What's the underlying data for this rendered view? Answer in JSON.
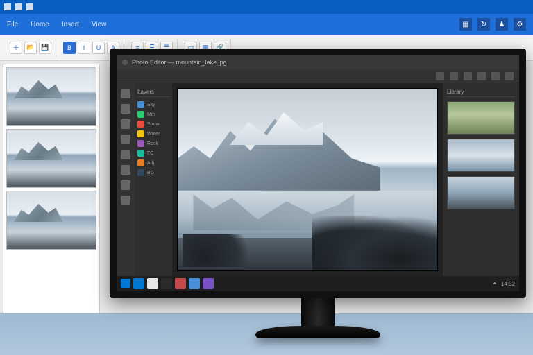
{
  "outer": {
    "ribbon_tabs": [
      "File",
      "Home",
      "Insert",
      "View"
    ],
    "ribbon_right_icons": [
      "grid-icon",
      "sync-icon",
      "user-icon",
      "settings-icon"
    ]
  },
  "left_panel": {
    "thumbs": [
      "mountain-lake-1",
      "mountain-lake-2",
      "mountain-lake-3"
    ]
  },
  "editor": {
    "title": "Photo Editor — mountain_lake.jpg",
    "top_icons": [
      "undo-icon",
      "redo-icon",
      "save-icon",
      "export-icon",
      "cloud-icon",
      "settings-icon"
    ],
    "side_tools": [
      "move-icon",
      "select-icon",
      "crop-icon",
      "brush-icon",
      "eraser-icon",
      "text-icon",
      "eyedropper-icon",
      "zoom-icon"
    ],
    "layers_title": "Layers",
    "layers": [
      {
        "name": "Sky",
        "color": "#4a90d9"
      },
      {
        "name": "Mtn",
        "color": "#2ecc71"
      },
      {
        "name": "Snow",
        "color": "#e74c3c"
      },
      {
        "name": "Water",
        "color": "#f1c40f"
      },
      {
        "name": "Rock",
        "color": "#9b59b6"
      },
      {
        "name": "FG",
        "color": "#1abc9c"
      },
      {
        "name": "Adj",
        "color": "#e67e22"
      },
      {
        "name": "BG",
        "color": "#34495e"
      }
    ],
    "right_panel_title": "Library",
    "library": [
      "forest-valley",
      "snow-ridge",
      "lake-dawn"
    ],
    "taskbar": {
      "apps": [
        "#0078d4",
        "#e8e8e8",
        "#2b2b2b",
        "#c24a4a",
        "#4a90d9",
        "#7a52c7"
      ],
      "clock": "14:32"
    }
  }
}
